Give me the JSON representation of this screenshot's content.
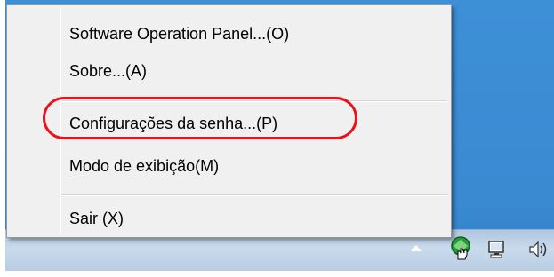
{
  "context_menu": {
    "items": [
      {
        "label": "Software Operation Panel...(O)"
      },
      {
        "label": "Sobre...(A)"
      },
      {
        "label": "Configurações da senha...(P)"
      },
      {
        "label": "Modo de exibição(M)"
      },
      {
        "label": "Sair (X)"
      }
    ],
    "highlighted_item": "Configurações da senha...(P)",
    "highlight_color": "#e8141b"
  },
  "tray": {
    "icons": [
      "show-hidden-icons-arrow",
      "scanner-app-icon",
      "network-icon",
      "volume-icon"
    ]
  },
  "colors": {
    "desktop": "#3a8ad2",
    "menu_background": "#f0f0f0",
    "taskbar": "#c9daec"
  }
}
